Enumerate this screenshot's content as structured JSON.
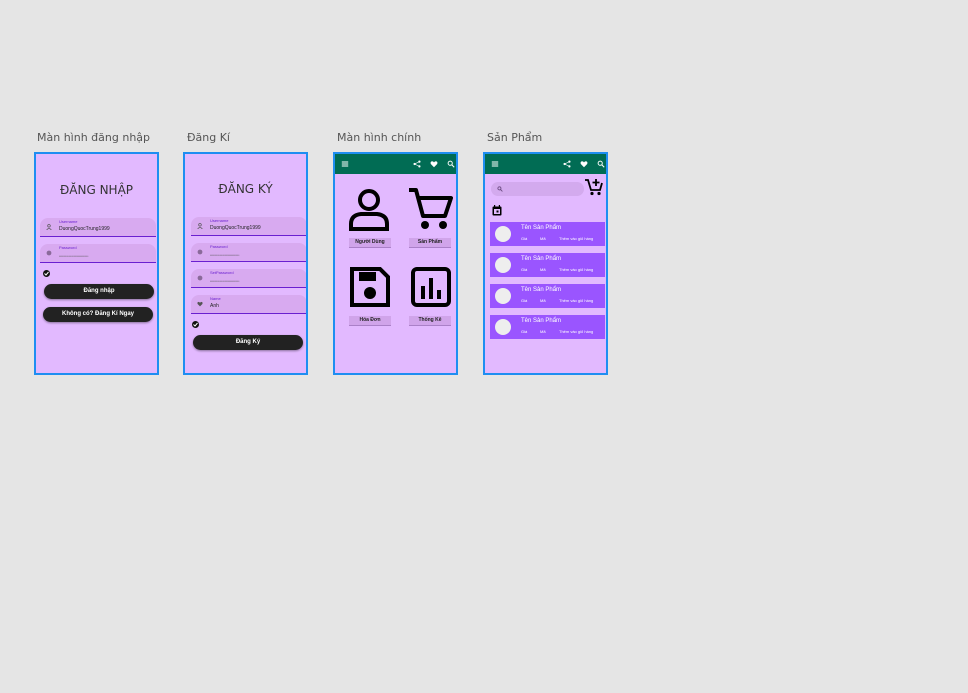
{
  "frames": [
    {
      "title": "Màn hình đăng nhập"
    },
    {
      "title": "Đăng Kí"
    },
    {
      "title": "Màn hình  chính"
    },
    {
      "title": "Sản Phẩm"
    }
  ],
  "login": {
    "heading": "ĐĂNG NHẬP",
    "username_label": "Username",
    "username_value": "DuongQuocTrung1999",
    "password_label": "Password",
    "password_value": "••••••••••••••••••••••••••••",
    "login_button": "Đăng nhập",
    "register_link": "Không có? Đăng Kí Ngay"
  },
  "register": {
    "heading": "ĐĂNG KÝ",
    "username_label": "Username",
    "username_value": "DuongQuocTrung1999",
    "password_label": "Password",
    "password_value": "••••••••••••••••••••••••••••",
    "setpassword_label": "SetPassword",
    "setpassword_value": "••••••••••••••••••••••••••••",
    "name_label": "Name",
    "name_value": "Anh",
    "register_button": "Đăng Ký"
  },
  "main": {
    "tiles": [
      {
        "label": "Người Dùng",
        "icon": "person-icon"
      },
      {
        "label": "Sản Phẩm",
        "icon": "cart-icon"
      },
      {
        "label": "Hóa Đơn",
        "icon": "save-icon"
      },
      {
        "label": "Thống Kê",
        "icon": "bar-chart-icon"
      }
    ]
  },
  "products": {
    "items": [
      {
        "name": "Tên Sản Phẩm",
        "price": "Giá",
        "code": "Mã",
        "action": "Thêm vào giỏ hàng"
      },
      {
        "name": "Tên Sản Phẩm",
        "price": "Giá",
        "code": "Mã",
        "action": "Thêm vào giỏ hàng"
      },
      {
        "name": "Tên Sản Phẩm",
        "price": "Giá",
        "code": "Mã",
        "action": "Thêm vào giỏ hàng"
      },
      {
        "name": "Tên Sản Phẩm",
        "price": "Giá",
        "code": "Mã",
        "action": "Thêm vào giỏ hàng"
      }
    ]
  },
  "colors": {
    "canvas": "#e5e5e5",
    "frame_bg": "#e2b9ff",
    "frame_border": "#1f8ef1",
    "appbar": "#016c54",
    "product_row": "#9a55ff",
    "button": "#222222"
  }
}
